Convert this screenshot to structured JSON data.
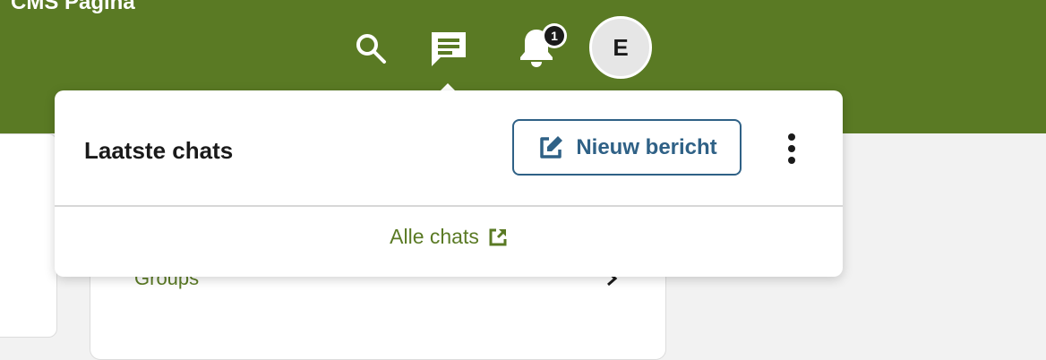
{
  "header": {
    "app_title": "CMS Pagina",
    "icons": {
      "search": "search-icon",
      "chat": "chat-icon",
      "notifications": "bell-icon"
    },
    "notification_count": "1",
    "avatar_initial": "E",
    "brand_color": "#5a7a24"
  },
  "chat_dropdown": {
    "title": "Laatste chats",
    "new_message_label": "Nieuw bericht",
    "new_message_icon": "edit-icon",
    "more_icon": "more-vertical-icon",
    "all_chats_label": "Alle chats",
    "all_chats_icon": "external-link-icon",
    "accent_color": "#2f6186"
  },
  "background": {
    "groups_label": "Groups",
    "groups_chevron_icon": "chevron-right-icon"
  }
}
